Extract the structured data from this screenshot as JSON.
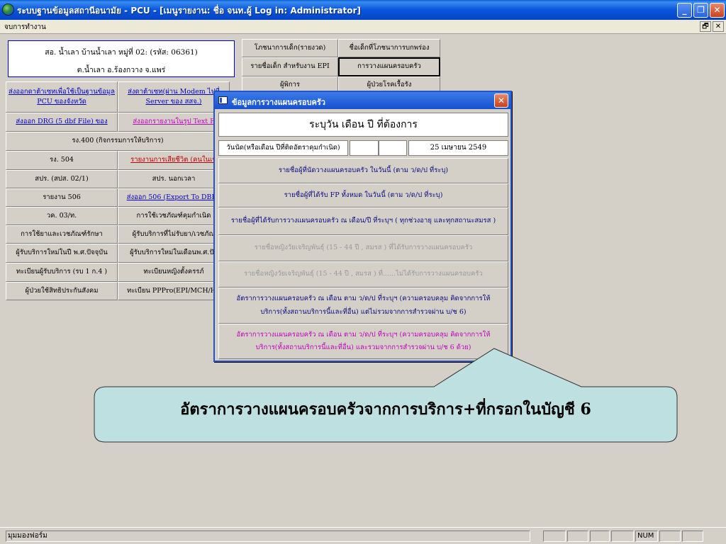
{
  "window": {
    "title": "ระบบฐานข้อมูลสถานีอนามัย - PCU - [เมนูรายงาน: ชื่อ จนท.ผู้ Log in: Administrator]",
    "buttons": {
      "minimize": "_",
      "restore": "❐",
      "close": "✕"
    }
  },
  "menu": {
    "item": "จบการทำงาน",
    "restore": "🗗",
    "close": "✕"
  },
  "clinic": {
    "line1": "สอ.  น้ำเลา บ้านน้ำเลา หมู่ที่ 02: (รหัส: 06361)",
    "line2": "ต.น้ำเลา อ.ร้องกวาง  จ.แพร่"
  },
  "grid_left": {
    "row1a": "ส่งออกดาต้าเซทเพื่อใช้เป็นฐานข้อมูล PCU ของจังหวัด",
    "row1b": "ส่งดาต้าเซท(ผ่าน Modem ไปที่ Server ของ สสจ.)",
    "row2a": "ส่งออก DRG (5 dbf File) ของ",
    "row2b": "ส่งออกรายงานในรูป Text F",
    "row3": "รง.400 (กิจกรรมการให้บริการ)",
    "row4a": "รง. 504",
    "row4b": "รายงานการเสียชีวิต (คนในเข",
    "row5a": "สปร. (สปส. 02/1)",
    "row5b": "สปร. นอกเวลา",
    "row6a": "รายงาน 506",
    "row6b": "ส่งออก 506 (Export To DBF /",
    "row7a": "วค. 03/ท.",
    "row7b": "การใช้เวชภัณฑ์คุมกำเนิด",
    "row8a": "การใช้ยาและเวชภัณฑ์รักษา",
    "row8b": "ผู้รับบริการที่ไม่รับยา/เวชภัณ",
    "row9a": "ผู้รับบริการใหม่ในปี พ.ศ.ปัจจุบัน",
    "row9b": "ผู้รับบริการใหม่ในเดือนพ.ศ.ปัจ",
    "row10a": "ทะเบียนผู้รับบริการ (รบ 1 ก.4 )",
    "row10b": "ทะเบียนหญิงตั้งครรภ์",
    "row11a": "ผู้ป่วยใช้สิทธิประกันสังคม",
    "row11b": "ทะเบียน PPPro(EPI/MCH/Ho"
  },
  "grid_right": {
    "r1a": "โภชนาการเด็ก(รายงวด)",
    "r1b": "ชื่อเด็กที่โภชนาการบกพร่อง",
    "r2a": "รายชื่อเด็ก สำหรับงาน EPI",
    "r2b": "การวางแผนครอบครัว",
    "r3a": "ผู้พิการ",
    "r3b": "ผู้ป่วยโรคเรื้อรัง"
  },
  "dialog": {
    "title": "ข้อมูลการวางแผนครอบครัว",
    "close": "✕",
    "header": "ระบุวัน เดือน ปี ที่ต้องการ",
    "date_label": "วันนัด(หรือเดือน ปีที่ติดอัตราคุมกำเนิด)",
    "date_value": "25  เมษายน  2549",
    "btn1": "รายชื่อผู้ที่นัดวางแผนครอบครัว ในวันนี้ (ตาม ว/ด/ป ที่ระบุ)",
    "btn2": "รายชื่อผู้ที่ได้รับ FP ทั้งหมด ในวันนี้ (ตาม ว/ด/ป ที่ระบุ)",
    "btn3": "รายชื่อผู้ที่ได้รับการวางแผนครอบครัว ณ เดือน/ปี ที่ระบุฯ ( ทุกช่วงอายุ และทุกสถานะสมรส )",
    "btn4": "รายชื่อหญิงวัยเจริญพันธุ์ (15 - 44 ปี , สมรส ) ที่ได้รับการวางแผนครอบครัว",
    "btn5": "รายชื่อหญิงวัยเจริญพันธุ์ (15 - 44 ปี , สมรส ) ที่......ไม่ได้รับการวางแผนครอบครัว",
    "btn6": "อัตราการวางแผนครอบครัว ณ เดือน ตาม ว/ด/ป ที่ระบุฯ (ความครอบคลุม คิดจากการให้บริการ(ทั้งสถานบริการนี้และที่อื่น) แต่ไม่รวมจากการสำรวจผ่าน บ/ช 6)",
    "btn7": "อัตราการวางแผนครอบครัว ณ เดือน ตาม ว/ด/ป ที่ระบุฯ (ความครอบคลุม คิดจากการให้บริการ(ทั้งสถานบริการนี้และที่อื่น) และรวมจากการสำรวจผ่าน บ/ช 6 ด้วย)"
  },
  "callout": {
    "text": "อัตราการวางแผนครอบครัวจากการบริการ+ที่กรอกในบัญชี 6"
  },
  "status": {
    "form": "มุมมองฟอร์ม",
    "num": "NUM"
  },
  "colors": {
    "titlebar": "#0855dd",
    "callout_fill": "#bfe0e0",
    "link": "#0000c0",
    "magenta": "#c000c0"
  }
}
